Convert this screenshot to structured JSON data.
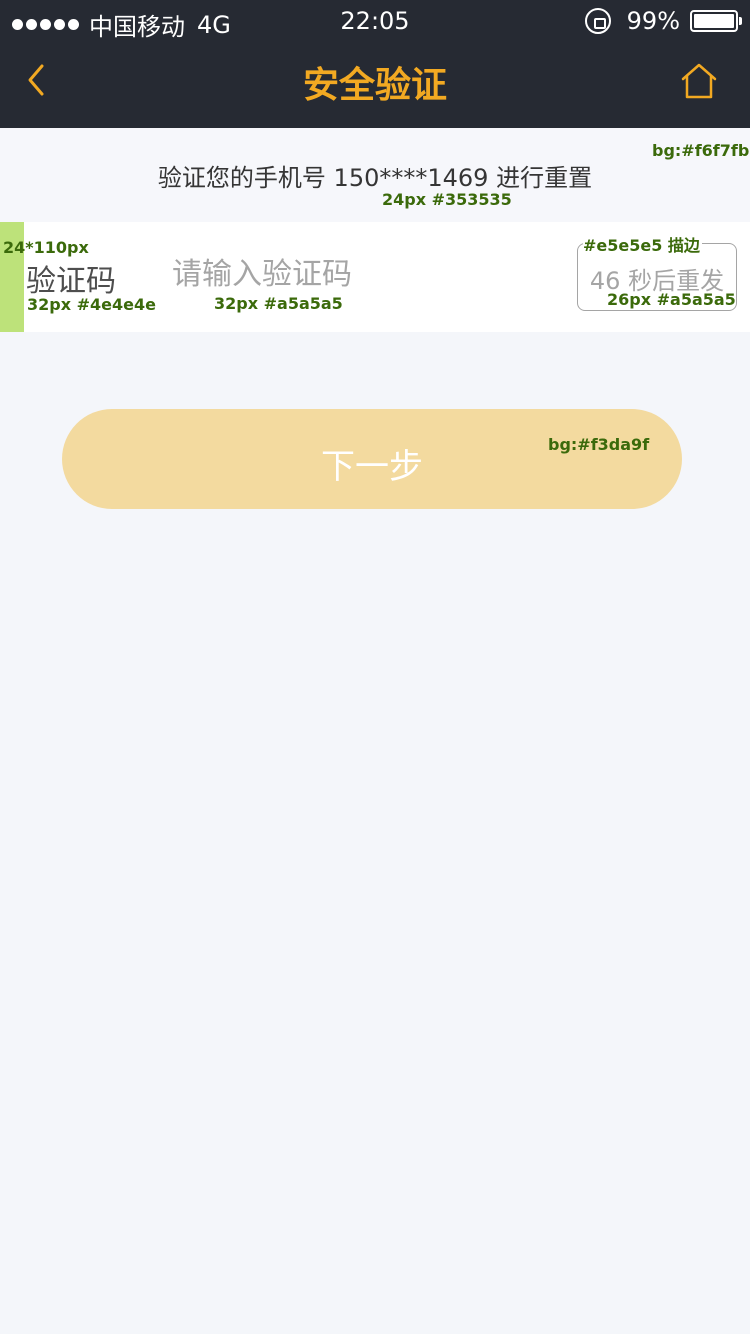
{
  "status_bar": {
    "carrier": "中国移动",
    "network": "4G",
    "time": "22:05",
    "battery": "99%",
    "battery_level": 0.99
  },
  "nav": {
    "title": "安全验证",
    "back_icon": "chevron-left-icon",
    "home_icon": "home-icon"
  },
  "notice": {
    "text": "验证您的手机号 150****1469 进行重置"
  },
  "code_row": {
    "label": "验证码",
    "input_placeholder": "请输入验证码",
    "input_value": "",
    "resend_label": "46 秒后重发"
  },
  "next_button": {
    "label": "下一步"
  },
  "annotations": {
    "notice_bg": "bg:#f6f7fb",
    "notice_text": "24px  #353535",
    "marker": "24*110px",
    "label_spec": "32px #4e4e4e",
    "placeholder_spec": "32px  #a5a5a5",
    "border_spec": "#e5e5e5 描边",
    "resend_spec": "26px  #a5a5a5",
    "button_bg": "bg:#f3da9f"
  },
  "colors": {
    "header_bg": "#262a33",
    "accent": "#f2a922",
    "page_bg": "#f4f6fa",
    "notice_bg": "#f6f7fb",
    "notice_text": "#353535",
    "label_text": "#4e4e4e",
    "placeholder_text": "#a5a5a5",
    "button_bg": "#f3da9f"
  }
}
